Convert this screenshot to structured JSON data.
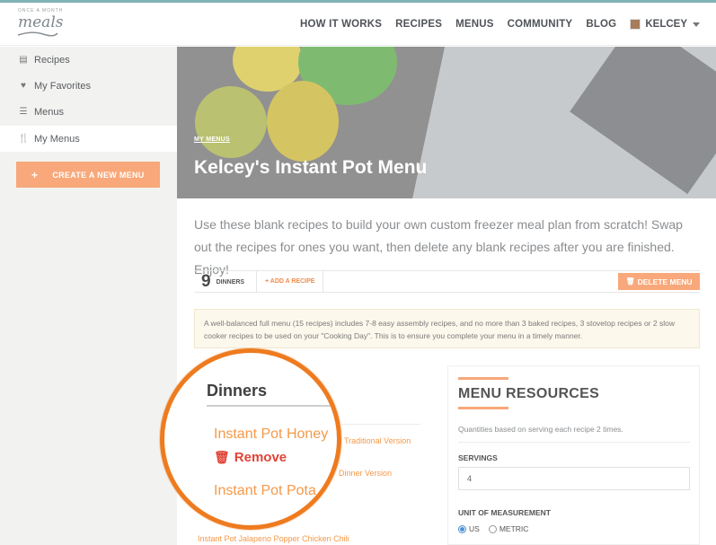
{
  "logo": {
    "tagline": "ONCE A MONTH",
    "wordmark": "meals"
  },
  "nav": {
    "items": [
      "HOW IT WORKS",
      "RECIPES",
      "MENUS",
      "COMMUNITY",
      "BLOG"
    ],
    "user": "KELCEY"
  },
  "sidebar": {
    "items": [
      {
        "label": "Recipes",
        "icon": "book-icon"
      },
      {
        "label": "My Favorites",
        "icon": "heart-icon"
      },
      {
        "label": "Menus",
        "icon": "list-icon"
      },
      {
        "label": "My Menus",
        "icon": "utensils-icon",
        "active": true
      }
    ],
    "create_button": "CREATE A NEW MENU",
    "create_icon": "+"
  },
  "hero": {
    "breadcrumb": "MY MENUS",
    "title": "Kelcey's Instant Pot Menu"
  },
  "intro": "Use these blank recipes to build your own custom freezer meal plan from scratch! Swap out the recipes for ones you want, then delete any blank recipes after you are finished. Enjoy!",
  "toolbar": {
    "count": "9",
    "count_label": "DINNERS",
    "add_recipe": "+ ADD A RECIPE",
    "delete_menu": "DELETE MENU"
  },
  "notice": "A well-balanced full menu (15 recipes) includes 7-8 easy assembly recipes, and no more than 3 baked recipes, 3 stovetop recipes or 2 slow cooker recipes to be used on your \"Cooking Day\". This is to ensure you complete your menu in a timely manner.",
  "dinners": {
    "partial_link_1": "Traditional Version",
    "partial_link_2": "Dinner Version",
    "link_3": "Instant Pot Jalapeno Popper Chicken Chili"
  },
  "resources": {
    "title": "MENU RESOURCES",
    "subtitle": "Quantities based on serving each recipe 2 times.",
    "servings_label": "SERVINGS",
    "servings_value": "4",
    "unit_label": "UNIT OF MEASUREMENT",
    "unit_options": [
      "US",
      "METRIC"
    ],
    "unit_selected": "US"
  },
  "magnifier": {
    "heading": "Dinners",
    "recipe_1": "Instant Pot Honey",
    "remove": "Remove",
    "recipe_2": "Instant Pot Pota"
  },
  "colors": {
    "accent": "#f8a87a",
    "link": "#f5994a",
    "highlight_ring": "#ee7b1f",
    "remove": "#e14437"
  }
}
